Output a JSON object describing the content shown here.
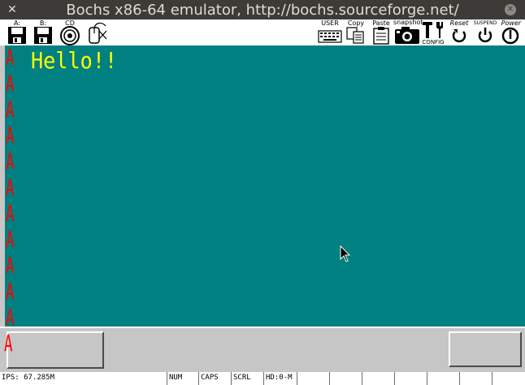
{
  "window": {
    "title": "Bochs x86-64 emulator, http://bochs.sourceforge.net/",
    "close_glyph": "✕",
    "maximize_glyph": "✕"
  },
  "toolbar": {
    "floppy_a_label": "A:",
    "floppy_b_label": "B:",
    "cdrom_label": "CD",
    "user_label": "USER",
    "copy_label": "Copy",
    "paste_label": "Paste",
    "snapshot_label": "snapshot",
    "config_label": "CONFIG",
    "reset_label": "Reset",
    "suspend_label": "SUSPEND",
    "power_label": "Power"
  },
  "screen": {
    "hello_text": "Hello!!",
    "column_char": "A",
    "column_rows": [
      "A",
      "A",
      "A",
      "A",
      "A",
      "A",
      "A",
      "A",
      "A",
      "A",
      "A"
    ],
    "background_color": "#008080",
    "text_color": "#ffff00",
    "char_color": "#ff0000"
  },
  "lower": {
    "bottom_char": "A"
  },
  "statusbar": {
    "ips": "IPS: 67.285M",
    "num": "NUM",
    "caps": "CAPS",
    "scrl": "SCRL",
    "hd": "HD:0-M"
  }
}
